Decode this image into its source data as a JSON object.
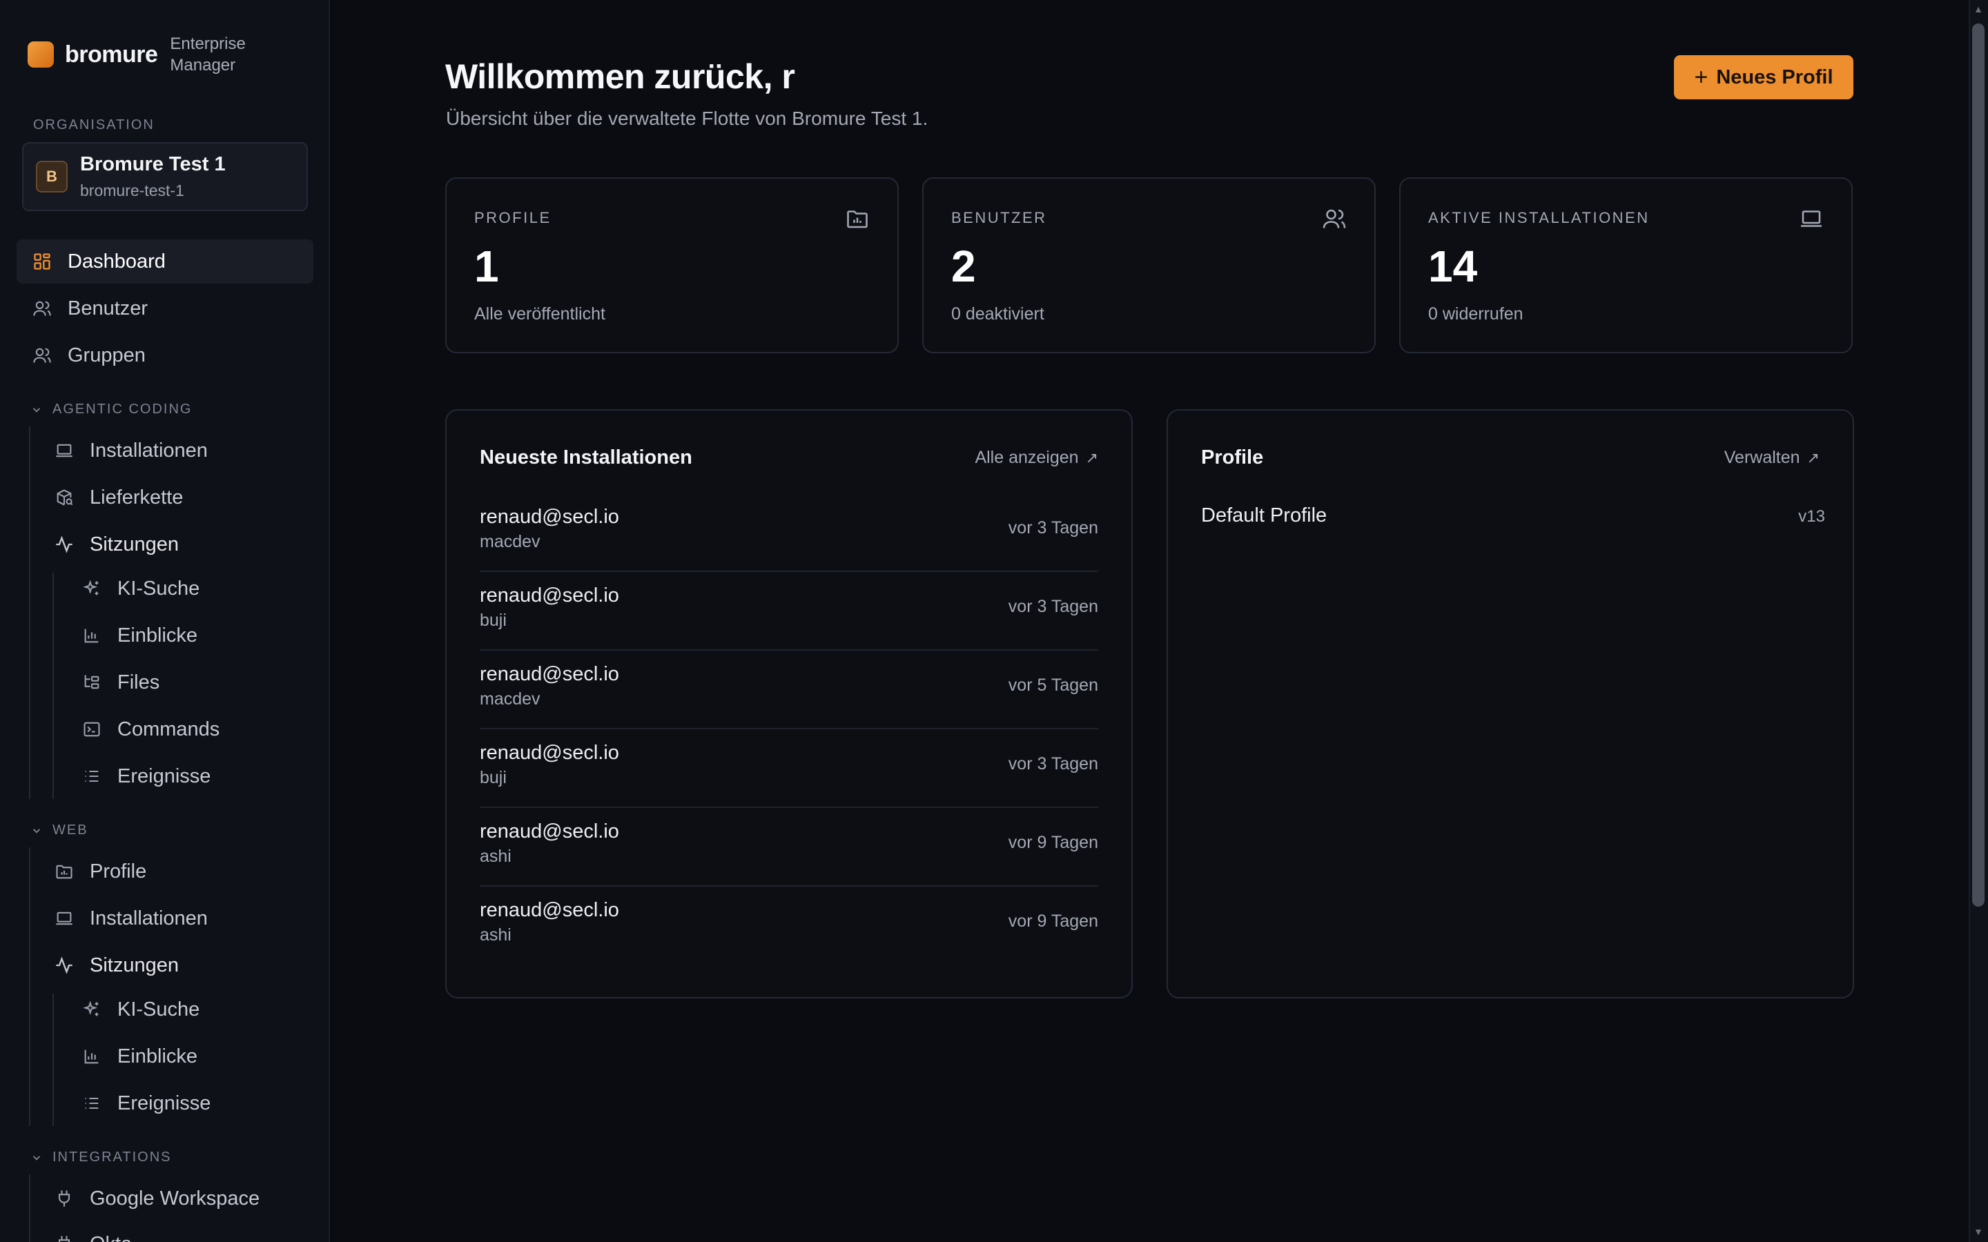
{
  "brand": {
    "name": "bromure",
    "subtitle": "Enterprise Manager"
  },
  "org": {
    "label": "ORGANISATION",
    "avatar": "B",
    "name": "Bromure Test 1",
    "slug": "bromure-test-1"
  },
  "nav": {
    "dashboard": "Dashboard",
    "users": "Benutzer",
    "groups": "Gruppen",
    "agentic": {
      "header": "AGENTIC CODING",
      "installations": "Installationen",
      "supply_chain": "Lieferkette",
      "sessions": "Sitzungen",
      "ai_search": "KI-Suche",
      "insights": "Einblicke",
      "files": "Files",
      "commands": "Commands",
      "events": "Ereignisse"
    },
    "web": {
      "header": "WEB",
      "profiles": "Profile",
      "installations": "Installationen",
      "sessions": "Sitzungen",
      "ai_search": "KI-Suche",
      "insights": "Einblicke",
      "events": "Ereignisse"
    },
    "integrations": {
      "header": "INTEGRATIONS",
      "google": "Google Workspace",
      "next": "Okta"
    }
  },
  "main": {
    "title": "Willkommen zurück, r",
    "subtitle": "Übersicht über die verwaltete Flotte von Bromure Test 1.",
    "new_profile": "Neues Profil"
  },
  "stats": [
    {
      "label": "PROFILE",
      "value": "1",
      "note": "Alle veröffentlicht",
      "icon": "folder-chart-icon"
    },
    {
      "label": "BENUTZER",
      "value": "2",
      "note": "0 deaktiviert",
      "icon": "users-icon"
    },
    {
      "label": "AKTIVE INSTALLATIONEN",
      "value": "14",
      "note": "0 widerrufen",
      "icon": "laptop-icon"
    }
  ],
  "installs_panel": {
    "title": "Neueste Installationen",
    "link": "Alle anzeigen",
    "rows": [
      {
        "email": "renaud@secl.io",
        "host": "macdev",
        "when": "vor 3 Tagen"
      },
      {
        "email": "renaud@secl.io",
        "host": "buji",
        "when": "vor 3 Tagen"
      },
      {
        "email": "renaud@secl.io",
        "host": "macdev",
        "when": "vor 5 Tagen"
      },
      {
        "email": "renaud@secl.io",
        "host": "buji",
        "when": "vor 3 Tagen"
      },
      {
        "email": "renaud@secl.io",
        "host": "ashi",
        "when": "vor 9 Tagen"
      },
      {
        "email": "renaud@secl.io",
        "host": "ashi",
        "when": "vor 9 Tagen"
      }
    ]
  },
  "profiles_panel": {
    "title": "Profile",
    "link": "Verwalten",
    "items": [
      {
        "name": "Default Profile",
        "version": "v13"
      }
    ]
  },
  "colors": {
    "accent": "#ed8f2f",
    "background": "#0a0c12",
    "sidebar": "#0f1118",
    "border": "#252935"
  }
}
